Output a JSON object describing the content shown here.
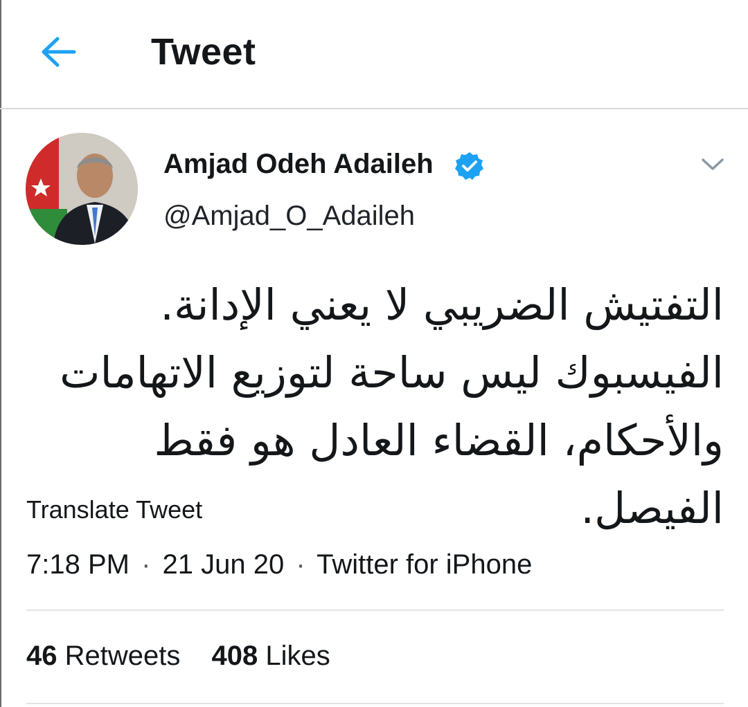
{
  "header": {
    "title": "Tweet",
    "back_icon": "arrow-left-icon",
    "accent_color": "#1da1f2"
  },
  "author": {
    "name": "Amjad Odeh Adaileh",
    "handle": "@Amjad_O_Adaileh",
    "verified_icon": "verified-badge-icon",
    "verified_color": "#1da1f2",
    "more_icon": "chevron-down-icon"
  },
  "tweet": {
    "text": "التفتيش الضريبي لا يعني الإدانة. الفيسبوك ليس ساحة لتوزيع الاتهامات والأحكام، القضاء العادل هو فقط الفيصل."
  },
  "translate_label": "Translate Tweet",
  "meta": {
    "time": "7:18 PM",
    "separator": "·",
    "date": "21 Jun 20",
    "source": "Twitter for iPhone"
  },
  "stats": {
    "retweets_count": "46",
    "retweets_label": "Retweets",
    "likes_count": "408",
    "likes_label": "Likes"
  }
}
